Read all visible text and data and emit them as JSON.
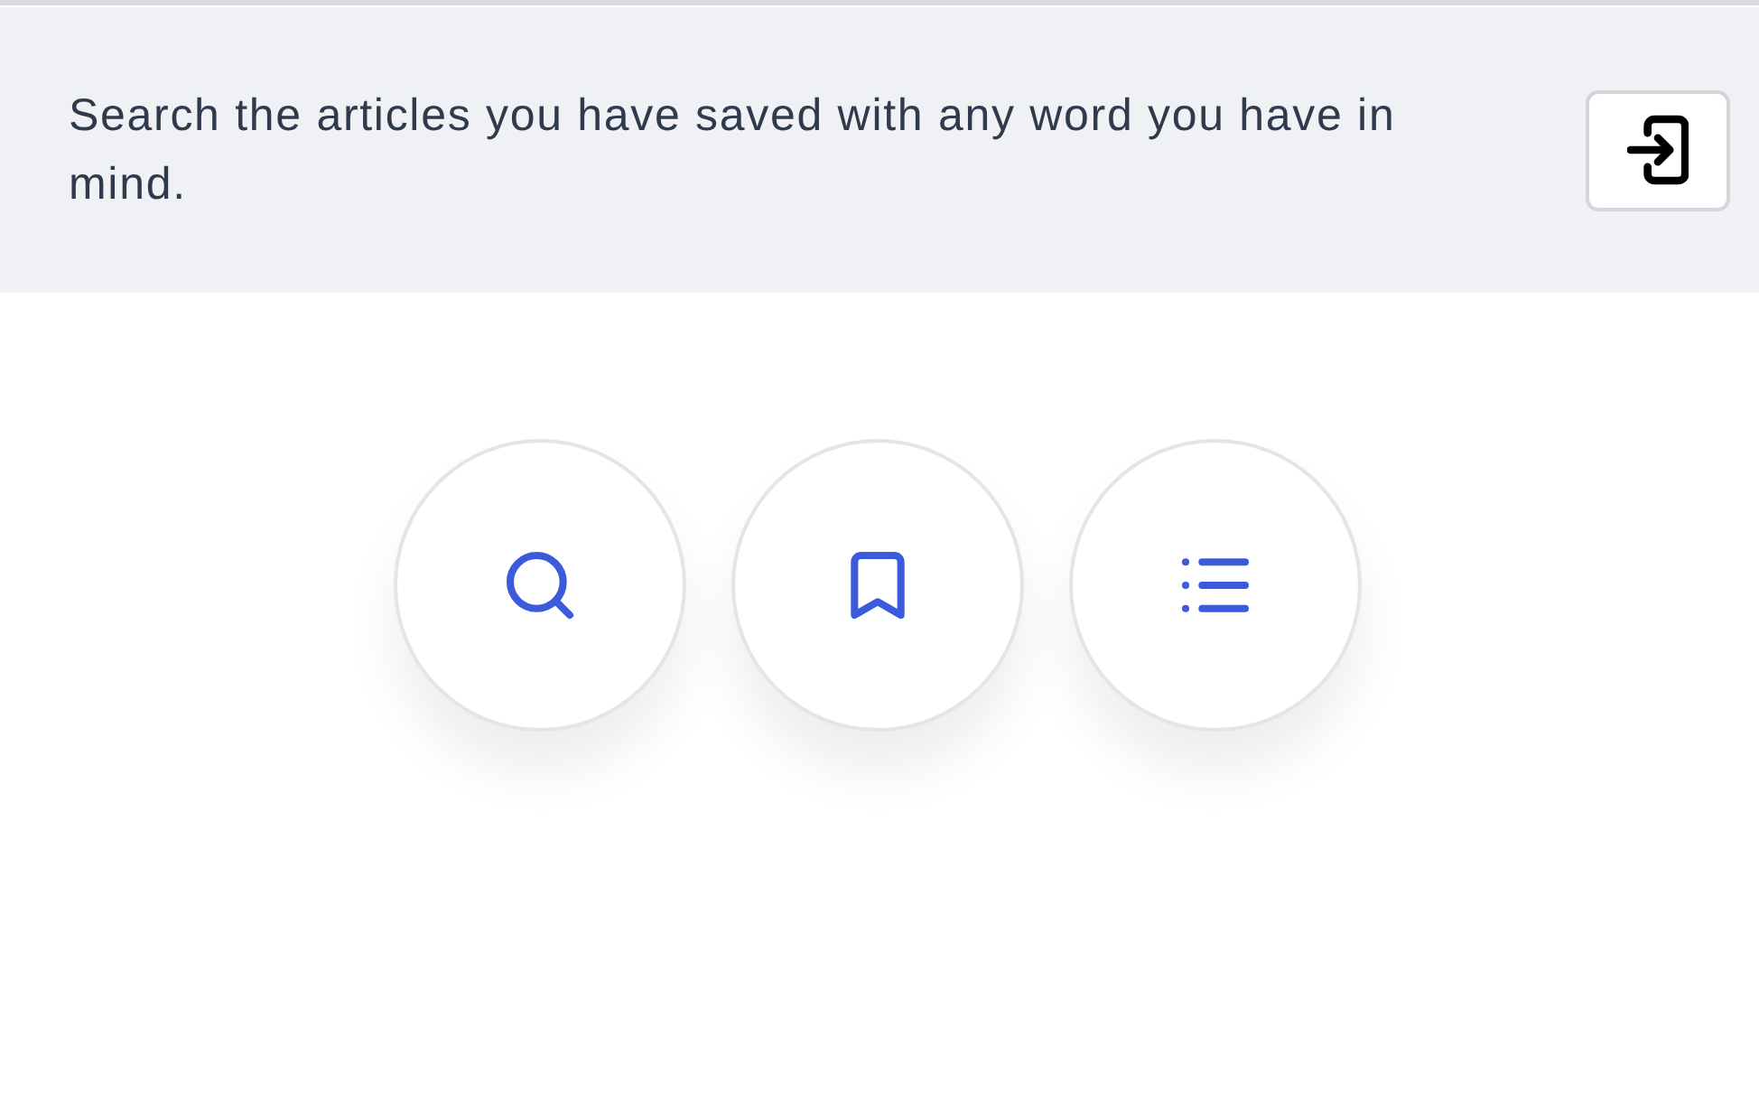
{
  "banner": {
    "text": "Search the articles you have saved with any word you have in mind."
  }
}
